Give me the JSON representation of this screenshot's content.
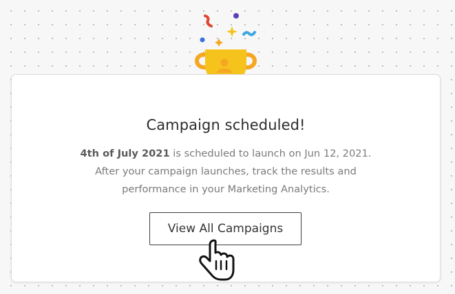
{
  "card": {
    "title": "Campaign scheduled!",
    "campaign_name": "4th of July 2021",
    "line1_rest": " is scheduled to launch on Jun 12, 2021.",
    "line2": "After your campaign launches, track the results and",
    "line3": "performance in your Marketing Analytics.",
    "button_label": "View All Campaigns"
  },
  "icons": {
    "trophy": "trophy-icon",
    "confetti": "confetti-icon",
    "cursor": "hand-pointer-icon"
  },
  "colors": {
    "trophy_gold": "#f6c31c",
    "trophy_orange": "#f5a623",
    "confetti_red": "#e0452f",
    "confetti_purple": "#5c3fb8",
    "confetti_blue": "#3da6e0",
    "confetti_yellow": "#f6c31c"
  }
}
